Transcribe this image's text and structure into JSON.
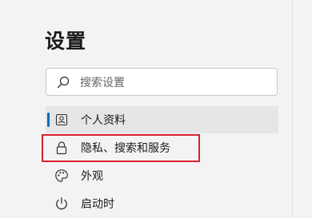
{
  "settings": {
    "title": "设置",
    "search": {
      "placeholder": "搜索设置",
      "value": "",
      "icon": "search-icon"
    },
    "nav": [
      {
        "label": "个人资料",
        "icon": "profile-icon",
        "active": true,
        "highlighted": false
      },
      {
        "label": "隐私、搜索和服务",
        "icon": "lock-icon",
        "active": false,
        "highlighted": true
      },
      {
        "label": "外观",
        "icon": "palette-icon",
        "active": false,
        "highlighted": false
      },
      {
        "label": "启动时",
        "icon": "power-icon",
        "active": false,
        "highlighted": false
      }
    ]
  },
  "colors": {
    "background": "#f3f3f3",
    "active_item_background": "#e6e6e6",
    "accent": "#0f6cbd",
    "highlight_box": "#d7212d"
  }
}
